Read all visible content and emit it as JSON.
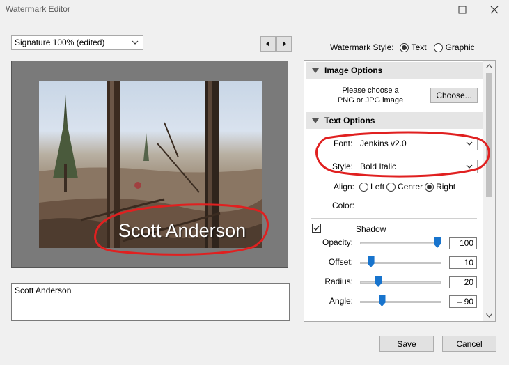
{
  "window": {
    "title": "Watermark Editor"
  },
  "preset": {
    "selected": "Signature 100% (edited)"
  },
  "style": {
    "label": "Watermark Style:",
    "options": [
      "Text",
      "Graphic"
    ],
    "selected": "Text"
  },
  "preview": {
    "watermark_text": "Scott Anderson"
  },
  "text_input": {
    "value": "Scott Anderson"
  },
  "image_options": {
    "header": "Image Options",
    "prompt_line1": "Please choose a",
    "prompt_line2": "PNG or JPG image",
    "choose_label": "Choose..."
  },
  "text_options": {
    "header": "Text Options",
    "font_label": "Font:",
    "font_value": "Jenkins v2.0",
    "style_label": "Style:",
    "style_value": "Bold Italic",
    "align_label": "Align:",
    "align_options": [
      "Left",
      "Center",
      "Right"
    ],
    "align_selected": "Right",
    "color_label": "Color:"
  },
  "shadow": {
    "label": "Shadow",
    "checked": true,
    "sliders": [
      {
        "label": "Opacity:",
        "value": "100",
        "fraction": 1.0
      },
      {
        "label": "Offset:",
        "value": "10",
        "fraction": 0.1
      },
      {
        "label": "Radius:",
        "value": "20",
        "fraction": 0.2
      },
      {
        "label": "Angle:",
        "value": "– 90",
        "fraction": 0.25
      }
    ]
  },
  "buttons": {
    "save": "Save",
    "cancel": "Cancel"
  },
  "colors": {
    "annotation": "#e02020",
    "slider_thumb": "#1874cd"
  }
}
